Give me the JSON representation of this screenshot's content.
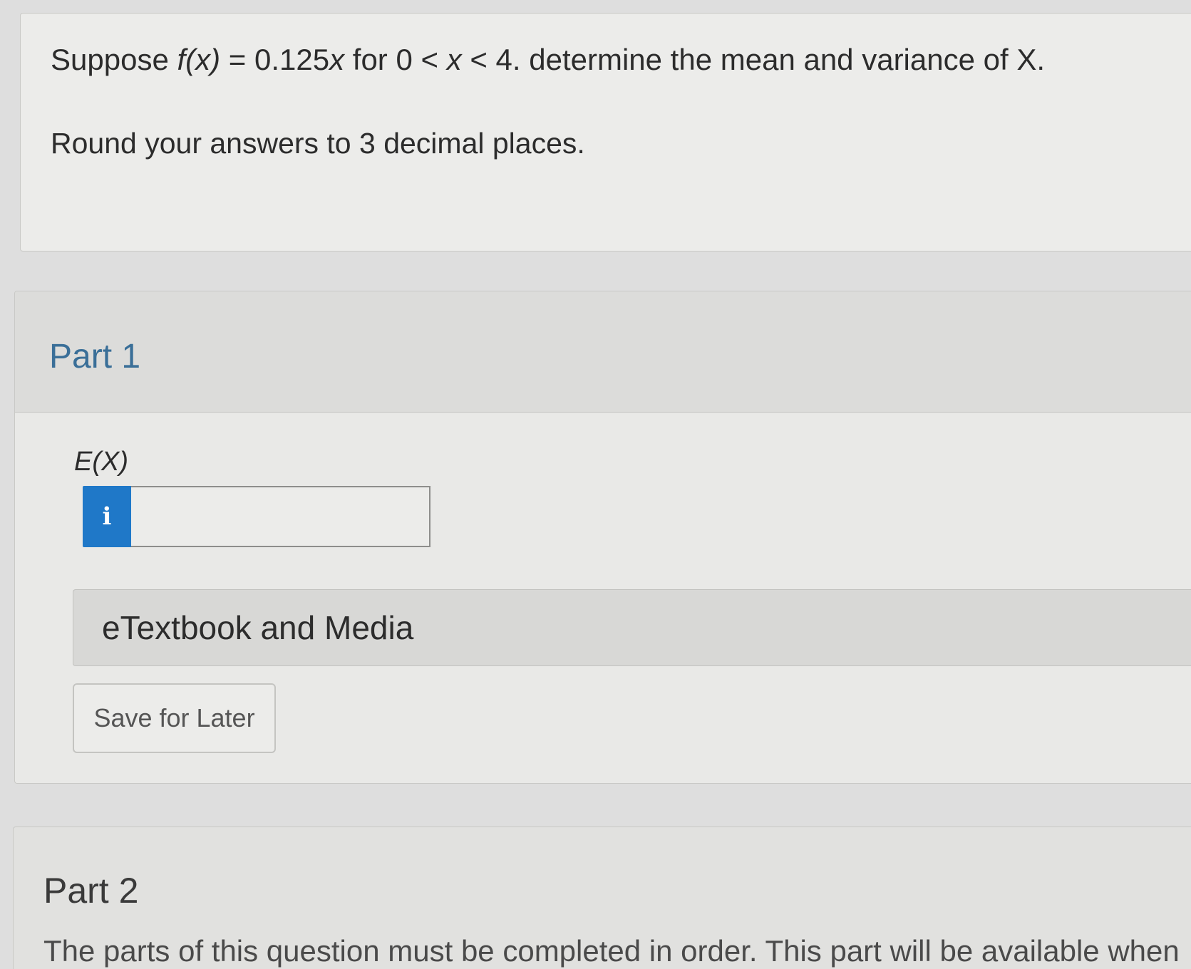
{
  "question": {
    "prefix": "Suppose ",
    "func": "f(x)",
    "eq_mid": " = 0.125",
    "var1": "x",
    "for_text": " for 0 < ",
    "var2": "x",
    "suffix": " < 4. determine the mean and variance of X.",
    "round_note": "Round your answers to 3 decimal places."
  },
  "part1": {
    "title": "Part 1",
    "answer_label": "E(X)",
    "info_icon": "info-icon",
    "info_symbol": "i",
    "answer_value": "",
    "etextbook_label": "eTextbook and Media",
    "save_label": "Save for Later"
  },
  "part2": {
    "title": "Part 2",
    "note": "The parts of this question must be completed in order. This part will be available when"
  },
  "colors": {
    "info_button": "#1f78c8",
    "part_title": "#3a6f98"
  }
}
